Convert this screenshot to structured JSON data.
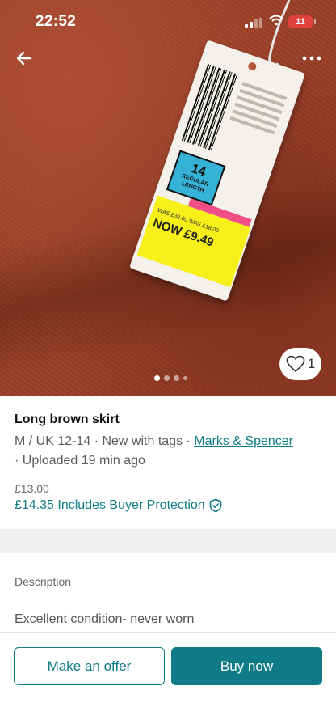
{
  "status_bar": {
    "time": "22:52",
    "battery": "11"
  },
  "photo": {
    "like_count": "1",
    "dots_total": 4,
    "dots_active_index": 0,
    "tag": {
      "size": "14",
      "size_length": "REGULAR LENGTH",
      "was_text": "WAS £38.00 WAS £18.00",
      "now_text": "NOW £9.49"
    }
  },
  "item": {
    "title": "Long brown skirt",
    "meta_prefix": "M / UK 12-14 · New with tags · ",
    "brand": "Marks & Spencer",
    "meta_suffix": "· Uploaded 19 min ago",
    "price": "£13.00",
    "price_with_protection": "£14.35 Includes Buyer Protection"
  },
  "description": {
    "label": "Description",
    "text": "Excellent condition- never worn"
  },
  "actions": {
    "offer_label": "Make an offer",
    "buy_label": "Buy now"
  },
  "colors": {
    "accent": "#0e7b86",
    "battery": "#e0413a"
  },
  "icons": {
    "back": "arrow-left-icon",
    "more": "more-horizontal-icon",
    "like": "heart-icon",
    "protection": "shield-check-icon"
  }
}
